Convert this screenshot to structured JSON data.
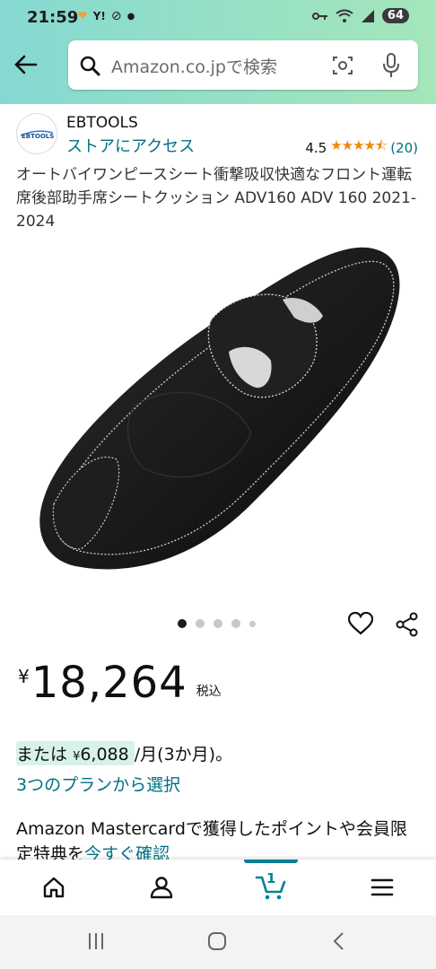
{
  "status_bar": {
    "time": "21:59",
    "left_icons": [
      "hearts-icon",
      "y-notification-icon",
      "sync-icon",
      "dot"
    ],
    "right_icons": [
      "key-icon",
      "wifi-icon",
      "signal-icon"
    ],
    "battery": "64"
  },
  "header": {
    "search_placeholder": "Amazon.co.jpで検索",
    "accent_color": "#85d9d2"
  },
  "brand": {
    "logo_text": "EBTOOLS",
    "name": "EBTOOLS",
    "store_link": "ストアにアクセス",
    "rating_value": "4.5",
    "stars": "★★★★⯪",
    "rating_count": "(20)"
  },
  "product": {
    "title": "オートバイワンピースシート衝撃吸収快適なフロント運転席後部助手席シートクッション ADV160 ADV 160 2021-2024",
    "image_count": 5,
    "active_image": 1
  },
  "price": {
    "currency": "¥",
    "amount": "18,264",
    "tax_label": "税込"
  },
  "installment": {
    "prefix": "または",
    "currency": "¥",
    "amount": "6,088",
    "suffix": "/月(3か月)。",
    "link": "3つのプランから選択"
  },
  "promo": {
    "text": "Amazon Mastercardで獲得したポイントや会員限定特典を",
    "link": "今すぐ確認"
  },
  "bottom_nav": {
    "items": [
      "home-icon",
      "account-icon",
      "cart-icon",
      "menu-icon"
    ],
    "cart_count": "1"
  }
}
